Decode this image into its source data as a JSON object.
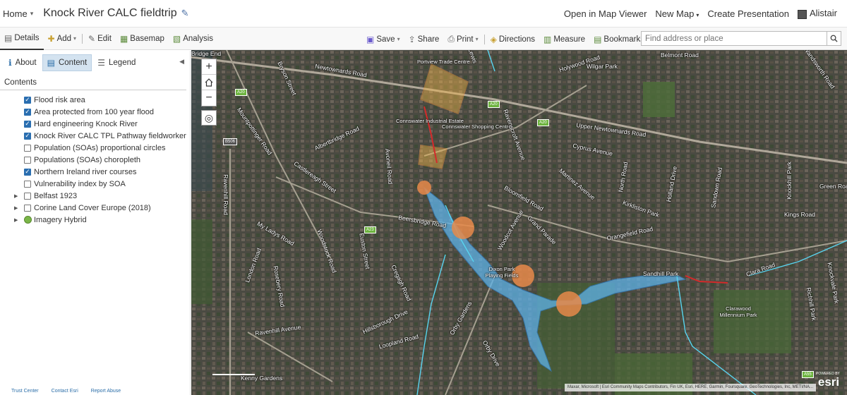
{
  "topbar": {
    "home": "Home",
    "title": "Knock River CALC fieldtrip",
    "open_map_viewer": "Open in Map Viewer",
    "new_map": "New Map",
    "create_presentation": "Create Presentation",
    "user": "Alistair"
  },
  "toolbar": {
    "details": "Details",
    "add": "Add",
    "edit": "Edit",
    "basemap": "Basemap",
    "analysis": "Analysis",
    "save": "Save",
    "share": "Share",
    "print": "Print",
    "directions": "Directions",
    "measure": "Measure",
    "bookmarks": "Bookmarks",
    "search_placeholder": "Find address or place"
  },
  "panel": {
    "tabs": {
      "about": "About",
      "content": "Content",
      "legend": "Legend"
    },
    "contents_heading": "Contents",
    "layers": [
      {
        "label": "Flood risk area",
        "checked": true
      },
      {
        "label": "Area protected from 100 year flood",
        "checked": true
      },
      {
        "label": "Hard engineering Knock River",
        "checked": true
      },
      {
        "label": "Knock River CALC TPL Pathway fieldworker",
        "checked": true
      },
      {
        "label": "Population (SOAs) proportional circles",
        "checked": false
      },
      {
        "label": "Populations (SOAs) choropleth",
        "checked": false
      },
      {
        "label": "Northern Ireland river courses",
        "checked": true
      },
      {
        "label": "Vulnerability index by SOA",
        "checked": false
      },
      {
        "label": "Belfast 1923",
        "checked": false,
        "expandable": true
      },
      {
        "label": "Corine Land Cover Europe (2018)",
        "checked": false,
        "expandable": true
      },
      {
        "label": "Imagery Hybrid",
        "checked": true,
        "expandable": true,
        "basemap": true
      }
    ],
    "footer": {
      "trust": "Trust Center",
      "contact": "Contact Esri",
      "report": "Report Abuse"
    }
  },
  "map": {
    "attribution": "Maxar, Microsoft | Esri Community Maps Contributors, Fin UK, Esri, HERE, Garmin, Foursquare, GeoTechnologies, Inc, METI/NA...",
    "powered_by": "POWERED BY",
    "esri": "esri",
    "labels": {
      "bridge_end": "Bridge End",
      "newtownards_road": "Newtownards Road",
      "holywood_road": "Holywood Road",
      "belmont_road": "Belmont Road",
      "wilgar_park": "Wilgar Park",
      "wandsworth_road": "Wandsworth Road",
      "upper_newtownards_road": "Upper Newtownards Road",
      "cyprus_avenue": "Cyprus Avenue",
      "connswater_shopping": "Connswater Shopping Centre",
      "connswater_industrial": "Connswater Industrial Estate",
      "portview": "Portview Trade Centre",
      "albertbridge_road": "Albertbridge Road",
      "castlereagh_street": "Castlereagh Street",
      "mountpottinger_road": "Mountpottinger Road",
      "bryson_street": "Bryson Street",
      "beersbridge_road": "Beersbridge Road",
      "bloomfield_road": "Bloomfield Road",
      "my_ladys_road": "My Ladys Road",
      "london_road": "London Road",
      "woodstock_road": "Woodstock Road",
      "ravenhill_road": "Ravenhill Road",
      "ravenhill_avenue": "Ravenhill Avenue",
      "rosebery_road": "Rosebery Road",
      "euston_street": "Euston Street",
      "cregagh_road": "Cregagh Road",
      "hillsborough_drive": "Hillsborough Drive",
      "loopland_road": "Loopland Road",
      "orby_gardens": "Orby Gardens",
      "orby_drive": "Orby Drive",
      "dixon_park": "Dixon Park Playing Fields",
      "sandhill_park": "Sandhill Park",
      "clara_road": "Clara Road",
      "clarawood": "Clarawood Millennium Park",
      "orangefield_road": "Orangefield Road",
      "kirkliston_park": "Kirkliston Park",
      "north_road": "North Road",
      "holland_drive": "Holland Drive",
      "kings_road": "Kings Road",
      "knockhill_park": "Knockhill Park",
      "green_road": "Green Road",
      "sandown_road": "Sandown Road",
      "richhill_park": "Richhill Park",
      "knockvale_park": "Knockvale Park",
      "martinez_avenue": "Martinez Avenue",
      "grand_parade": "Grand Parade",
      "woodcot_avenue": "Woodcot Avenue",
      "avoneil_road": "Avoneil Road",
      "ravenscroft": "Ravenscroft Avenue",
      "lewis": "Lewis",
      "kenny_gardens": "Kenny Gardens",
      "b506": "B506",
      "a20": "A20",
      "a23": "A23",
      "a55": "A55"
    }
  },
  "colors": {
    "accent": "#2a6eb0",
    "active_tab": "#d4e3f0",
    "flood_area": "#5fb3e8",
    "protected": "#f09a3e",
    "river_red": "#d42a2a",
    "circle": "#e8894a"
  }
}
